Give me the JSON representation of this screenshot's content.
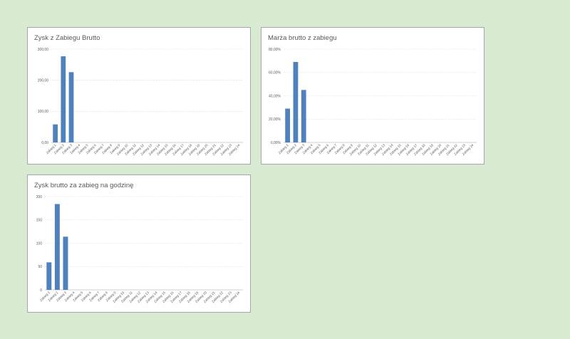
{
  "colors": {
    "bar": "#4f81bd",
    "grid": "#d9d9d9",
    "axis": "#bfbfbf",
    "background": "#d8ead1"
  },
  "chart_data": [
    {
      "type": "bar",
      "title": "Zysk z Zabiegu Brutto",
      "categories": [
        "Zabieg 1",
        "Zabieg 2",
        "Zabieg 3",
        "Zabieg 4",
        "Zabieg 5",
        "Zabieg 6",
        "Zabieg 7",
        "Zabieg 8",
        "Zabieg 9",
        "Zabieg 10",
        "Zabieg 11",
        "Zabieg 12",
        "Zabieg 13",
        "Zabieg 14",
        "Zabieg 15",
        "Zabieg 16",
        "Zabieg 17",
        "Zabieg 18",
        "Zabieg 19",
        "Zabieg 20",
        "Zabieg 21",
        "Zabieg 22",
        "Zabieg 23",
        "Zabieg 24"
      ],
      "values": [
        58,
        277,
        226,
        0,
        0,
        0,
        0,
        0,
        0,
        0,
        0,
        0,
        0,
        0,
        0,
        0,
        0,
        0,
        0,
        0,
        0,
        0,
        0,
        0
      ],
      "ylim": [
        0,
        300
      ],
      "yticks": [
        0,
        100,
        200,
        300
      ],
      "ytick_labels": [
        "0,00",
        "100,00",
        "200,00",
        "300,00"
      ],
      "xlabel": "",
      "ylabel": "",
      "grid": true,
      "legend": "none"
    },
    {
      "type": "bar",
      "title": "Marża brutto z zabiegu",
      "categories": [
        "Zabieg 1",
        "Zabieg 2",
        "Zabieg 3",
        "Zabieg 4",
        "Zabieg 5",
        "Zabieg 6",
        "Zabieg 7",
        "Zabieg 8",
        "Zabieg 9",
        "Zabieg 10",
        "Zabieg 11",
        "Zabieg 12",
        "Zabieg 13",
        "Zabieg 14",
        "Zabieg 15",
        "Zabieg 16",
        "Zabieg 17",
        "Zabieg 18",
        "Zabieg 19",
        "Zabieg 20",
        "Zabieg 21",
        "Zabieg 22",
        "Zabieg 23",
        "Zabieg 24"
      ],
      "values": [
        29,
        69,
        45,
        0,
        0,
        0,
        0,
        0,
        0,
        0,
        0,
        0,
        0,
        0,
        0,
        0,
        0,
        0,
        0,
        0,
        0,
        0,
        0,
        0
      ],
      "ylim": [
        0,
        80
      ],
      "yticks": [
        0,
        20,
        40,
        60,
        80
      ],
      "ytick_labels": [
        "0,00%",
        "20,00%",
        "40,00%",
        "60,00%",
        "80,00%"
      ],
      "xlabel": "",
      "ylabel": "",
      "grid": true,
      "legend": "none"
    },
    {
      "type": "bar",
      "title": "Zysk brutto za zabieg na godzinę",
      "categories": [
        "Zabieg 1",
        "Zabieg 2",
        "Zabieg 3",
        "Zabieg 4",
        "Zabieg 5",
        "Zabieg 6",
        "Zabieg 7",
        "Zabieg 8",
        "Zabieg 9",
        "Zabieg 10",
        "Zabieg 11",
        "Zabieg 12",
        "Zabieg 13",
        "Zabieg 14",
        "Zabieg 15",
        "Zabieg 16",
        "Zabieg 17",
        "Zabieg 18",
        "Zabieg 19",
        "Zabieg 20",
        "Zabieg 21",
        "Zabieg 22",
        "Zabieg 23",
        "Zabieg 24"
      ],
      "values": [
        59,
        184,
        114,
        0,
        0,
        0,
        0,
        0,
        0,
        0,
        0,
        0,
        0,
        0,
        0,
        0,
        0,
        0,
        0,
        0,
        0,
        0,
        0,
        0
      ],
      "ylim": [
        0,
        200
      ],
      "yticks": [
        0,
        50,
        100,
        150,
        200
      ],
      "ytick_labels": [
        "0",
        "50",
        "100",
        "150",
        "200"
      ],
      "xlabel": "",
      "ylabel": "",
      "grid": true,
      "legend": "none"
    }
  ]
}
